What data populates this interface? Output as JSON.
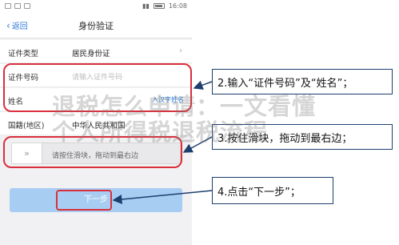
{
  "statusbar": {
    "time": "16:08"
  },
  "navbar": {
    "back_label": "返回",
    "title": "身份验证"
  },
  "form": {
    "rows": [
      {
        "label": "证件类型",
        "value": "居民身份证"
      },
      {
        "label": "证件号码",
        "placeholder": "请输入证件号码"
      },
      {
        "label": "姓名",
        "value": "",
        "tail": "入汉字姓名"
      },
      {
        "label": "国籍(地区)",
        "value": "中华人民共和国"
      }
    ]
  },
  "slider": {
    "knob": "»",
    "text": "请按住滑块，拖动到最右边"
  },
  "next_button": {
    "label": "下一步"
  },
  "callouts": {
    "c1": "2.输入“证件号码”及“姓名”；",
    "c2": "3.按住滑块，拖动到最右边；",
    "c3": "4.点击“下一步”；"
  },
  "watermark": {
    "line1": "退税怎么申请：一文看懂",
    "line2": "个人所得税退税流程"
  },
  "colors": {
    "highlight": "#d9303c",
    "callout_border": "#1d3f6e",
    "link": "#2f7bd8",
    "button": "#a8cdf3"
  }
}
